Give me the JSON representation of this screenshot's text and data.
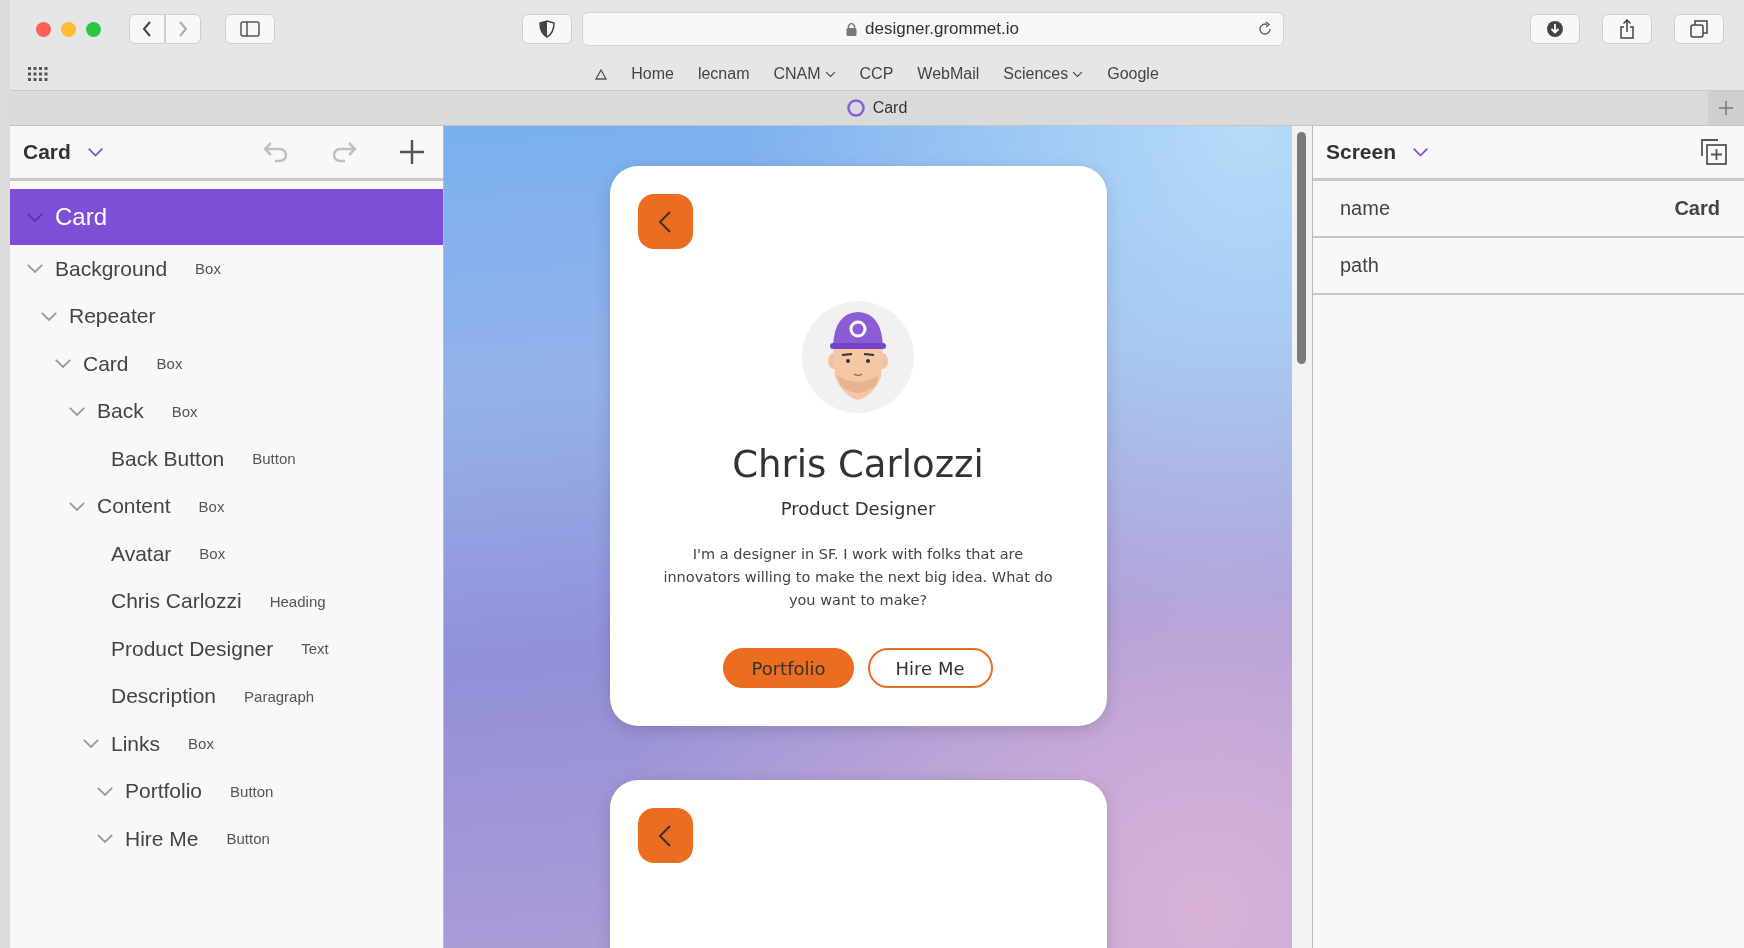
{
  "browser": {
    "url": "designer.grommet.io",
    "bookmarks": [
      {
        "label": "Home",
        "dropdown": false
      },
      {
        "label": "lecnam",
        "dropdown": false
      },
      {
        "label": "CNAM",
        "dropdown": true
      },
      {
        "label": "CCP",
        "dropdown": false
      },
      {
        "label": "WebMail",
        "dropdown": false
      },
      {
        "label": "Sciences",
        "dropdown": true
      },
      {
        "label": "Google",
        "dropdown": false
      }
    ],
    "tab": {
      "title": "Card"
    }
  },
  "left_panel": {
    "title": "Card",
    "tree": [
      {
        "label": "Card",
        "selected": true,
        "expanded": true,
        "children": [
          {
            "label": "Background",
            "type": "Box",
            "selected": false,
            "expanded": true,
            "children": [
              {
                "label": "Repeater",
                "selected": false,
                "expanded": true,
                "children": [
                  {
                    "label": "Card",
                    "type": "Box",
                    "selected": false,
                    "expanded": true,
                    "children": [
                      {
                        "label": "Back",
                        "type": "Box",
                        "selected": false,
                        "expanded": true,
                        "children": [
                          {
                            "label": "Back Button",
                            "type": "Button",
                            "selected": false
                          }
                        ]
                      },
                      {
                        "label": "Content",
                        "type": "Box",
                        "selected": false,
                        "expanded": true,
                        "children": [
                          {
                            "label": "Avatar",
                            "type": "Box",
                            "selected": false
                          },
                          {
                            "label": "Chris Carlozzi",
                            "type": "Heading",
                            "selected": false
                          },
                          {
                            "label": "Product Designer",
                            "type": "Text",
                            "selected": false
                          },
                          {
                            "label": "Description",
                            "type": "Paragraph",
                            "selected": false
                          },
                          {
                            "label": "Links",
                            "type": "Box",
                            "selected": false,
                            "expanded": true,
                            "children": [
                              {
                                "label": "Portfolio",
                                "type": "Button",
                                "selected": false,
                                "expanded": true
                              },
                              {
                                "label": "Hire Me",
                                "type": "Button",
                                "selected": false,
                                "expanded": true
                              }
                            ]
                          }
                        ]
                      }
                    ]
                  }
                ]
              }
            ]
          }
        ]
      }
    ]
  },
  "canvas": {
    "card": {
      "name": "Chris Carlozzi",
      "role": "Product Designer",
      "description": "I'm a designer in SF. I work with folks that are innovators willing to make the next big idea. What do you want to make?",
      "buttons": [
        {
          "label": "Portfolio",
          "kind": "primary"
        },
        {
          "label": "Hire Me",
          "kind": "secondary"
        }
      ]
    }
  },
  "right_panel": {
    "title": "Screen",
    "properties": [
      {
        "name": "name",
        "value": "Card"
      },
      {
        "name": "path"
      }
    ]
  }
}
